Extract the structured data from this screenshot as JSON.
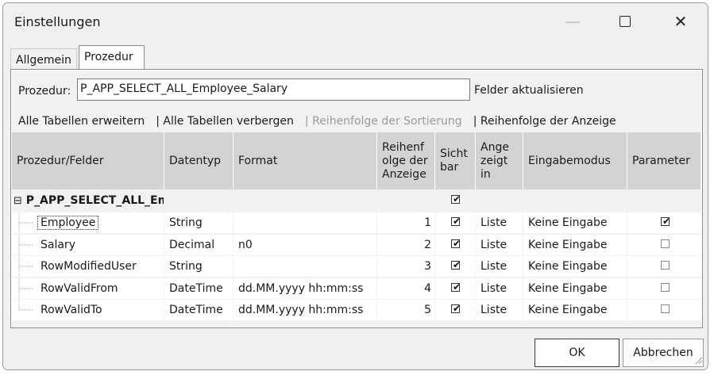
{
  "window": {
    "title": "Einstellungen"
  },
  "titlebar_controls": {
    "minimize_icon": "minimize-icon",
    "maximize_icon": "maximize-icon",
    "close_icon": "close-icon"
  },
  "tabs": [
    {
      "label": "Allgemein",
      "active": false
    },
    {
      "label": "Prozedur",
      "active": true
    }
  ],
  "procedure": {
    "label": "Prozedur:",
    "value": "P_APP_SELECT_ALL_Employee_Salary",
    "refresh_link": "Felder aktualisieren"
  },
  "toolbar": {
    "expand_all": "Alle Tabellen erweitern",
    "hide_all": "| Alle Tabellen verbergen",
    "sort_order": "| Reihenfolge der Sortierung",
    "display_order": "| Reihenfolge der Anzeige"
  },
  "grid": {
    "headers": {
      "field": "Prozedur/Felder",
      "datatype": "Datentyp",
      "format": "Format",
      "order_l1": "Reihenf",
      "order_l2": "olge der",
      "order_l3": "Anzeige",
      "visible_l1": "Sicht",
      "visible_l2": "bar",
      "shown_l1": "Ange",
      "shown_l2": "zeigt",
      "shown_l3": "in",
      "inputmode": "Eingabemodus",
      "parameter": "Parameter"
    },
    "group": {
      "name": "P_APP_SELECT_ALL_Em",
      "expander": "⊟",
      "visible": true
    },
    "rows": [
      {
        "field": "Employee",
        "datatype": "String",
        "format": "",
        "order": "1",
        "visible": true,
        "shown_in": "Liste",
        "inputmode": "Keine Eingabe",
        "parameter": true
      },
      {
        "field": "Salary",
        "datatype": "Decimal",
        "format": "n0",
        "order": "2",
        "visible": true,
        "shown_in": "Liste",
        "inputmode": "Keine Eingabe",
        "parameter": false
      },
      {
        "field": "RowModifiedUser",
        "datatype": "String",
        "format": "",
        "order": "3",
        "visible": true,
        "shown_in": "Liste",
        "inputmode": "Keine Eingabe",
        "parameter": false
      },
      {
        "field": "RowValidFrom",
        "datatype": "DateTime",
        "format": "dd.MM.yyyy hh:mm:ss",
        "order": "4",
        "visible": true,
        "shown_in": "Liste",
        "inputmode": "Keine Eingabe",
        "parameter": false
      },
      {
        "field": "RowValidTo",
        "datatype": "DateTime",
        "format": "dd.MM.yyyy hh:mm:ss",
        "order": "5",
        "visible": true,
        "shown_in": "Liste",
        "inputmode": "Keine Eingabe",
        "parameter": false
      }
    ]
  },
  "buttons": {
    "ok": "OK",
    "cancel": "Abbrechen"
  }
}
